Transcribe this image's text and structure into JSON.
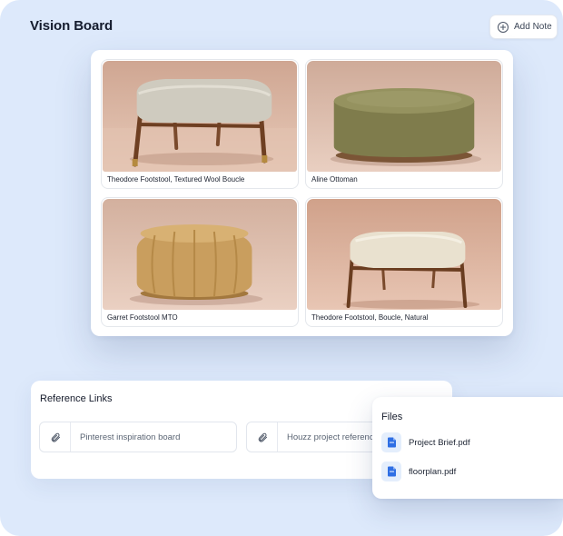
{
  "header": {
    "title": "Vision Board",
    "add_note_label": "Add Note"
  },
  "board": {
    "items": [
      {
        "caption": "Theodore Footstool, Textured Wool Boucle"
      },
      {
        "caption": "Aline Ottoman"
      },
      {
        "caption": "Garret Footstool MTO"
      },
      {
        "caption": "Theodore Footstool, Boucle, Natural"
      }
    ]
  },
  "reference_links": {
    "title": "Reference Links",
    "links": [
      {
        "label": "Pinterest inspiration board"
      },
      {
        "label": "Houzz project reference"
      }
    ]
  },
  "files": {
    "title": "Files",
    "items": [
      {
        "name": "Project Brief.pdf"
      },
      {
        "name": "floorplan.pdf"
      }
    ]
  },
  "colors": {
    "background": "#dde9fb",
    "file_icon": "#2f6fe4"
  }
}
